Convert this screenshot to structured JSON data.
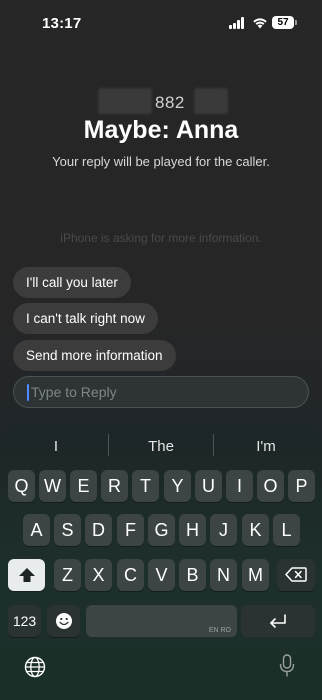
{
  "status_bar": {
    "time": "13:17",
    "battery": "57"
  },
  "caller": {
    "number": "882",
    "name": "Maybe: Anna",
    "subtitle": "Your reply will be played for the caller."
  },
  "info_text": "iPhone is asking for more information.",
  "quick_replies": [
    "I'll call you later",
    "I can't talk right now",
    "Send more information"
  ],
  "reply_input": {
    "placeholder": "Type to Reply"
  },
  "keyboard": {
    "predictions": [
      "I",
      "The",
      "I'm"
    ],
    "row1": [
      "Q",
      "W",
      "E",
      "R",
      "T",
      "Y",
      "U",
      "I",
      "O",
      "P"
    ],
    "row2": [
      "A",
      "S",
      "D",
      "F",
      "G",
      "H",
      "J",
      "K",
      "L"
    ],
    "row3": [
      "Z",
      "X",
      "C",
      "V",
      "B",
      "N",
      "M"
    ],
    "numbers_key": "123",
    "space_language": "EN RO"
  },
  "icons": [
    "shift-icon",
    "delete-icon",
    "emoji-icon",
    "return-icon",
    "globe-icon",
    "microphone-icon",
    "signal-icon",
    "wifi-icon",
    "battery-icon"
  ],
  "colors": {
    "cursor": "#4a8cff",
    "key": "#3c4444",
    "function_key": "#2a3232"
  }
}
